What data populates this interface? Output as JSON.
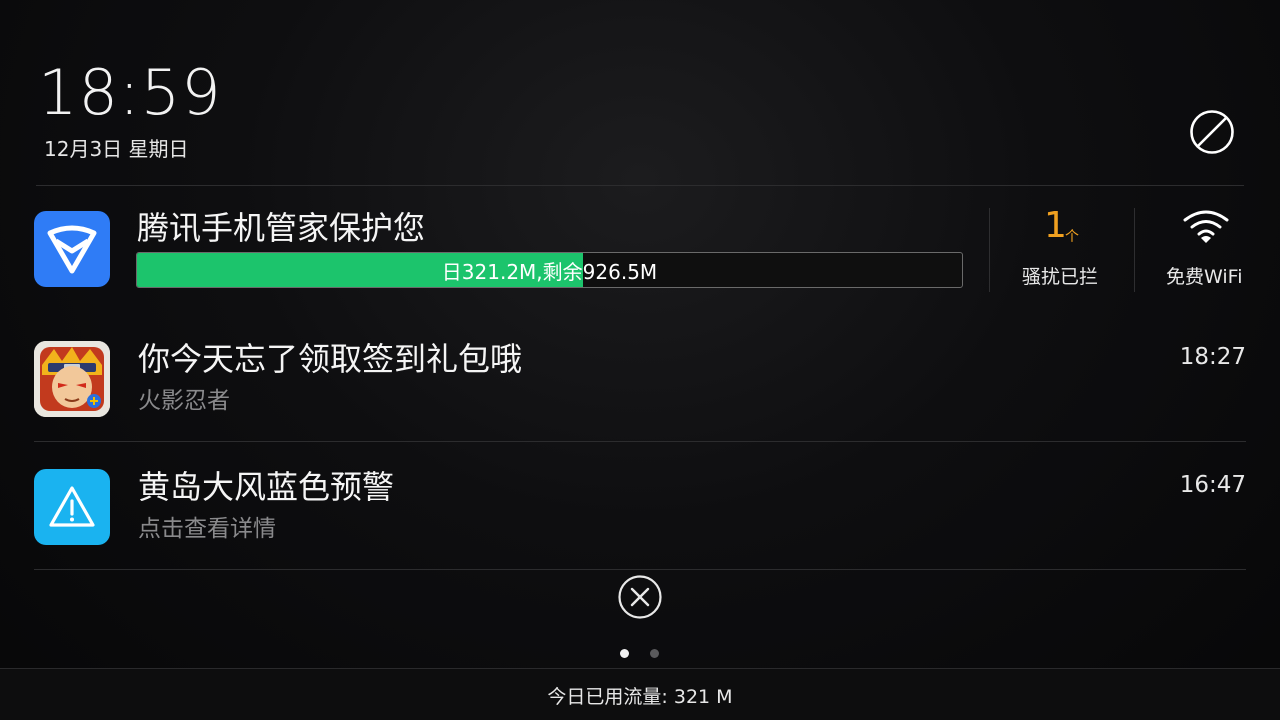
{
  "header": {
    "time": "18:59",
    "date": "12月3日 星期日"
  },
  "security_card": {
    "title": "腾讯手机管家保护您",
    "data_text": "日321.2M,剩余926.5M",
    "used_fraction": 0.54,
    "spam_count": "1",
    "spam_unit": "个",
    "spam_label": "骚扰已拦",
    "wifi_label": "免费WiFi"
  },
  "notifications": [
    {
      "title": "你今天忘了领取签到礼包哦",
      "app": "火影忍者",
      "time": "18:27",
      "icon": "naruto-game-icon"
    },
    {
      "title": "黄岛大风蓝色预警",
      "app": "点击查看详情",
      "time": "16:47",
      "icon": "warning-icon"
    }
  ],
  "pager": {
    "pages": 2,
    "active": 1
  },
  "footer": {
    "data_usage": "今日已用流量: 321 M"
  },
  "colors": {
    "accent_green": "#1cc46c",
    "guard_blue": "#2f7cf6",
    "alert_blue": "#1ab3f0",
    "spam_orange": "#f0a020"
  }
}
